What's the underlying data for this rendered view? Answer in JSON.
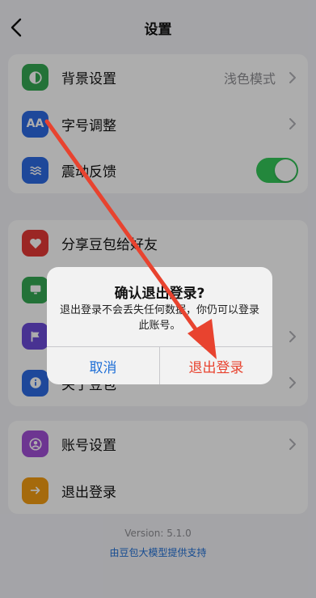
{
  "nav": {
    "title": "设置"
  },
  "groups": {
    "display": [
      {
        "label": "背景设置",
        "value": "浅色模式",
        "icon_text": "",
        "color": "#34a853"
      },
      {
        "label": "字号调整",
        "icon_text": "AA",
        "color": "#2d6be4"
      },
      {
        "label": "震动反馈",
        "toggle_on": true,
        "icon_text": "",
        "color": "#2d6be4"
      }
    ],
    "general": [
      {
        "label": "分享豆包给好友",
        "color": "#e53935"
      },
      {
        "label": "",
        "color": "#34a853"
      },
      {
        "label": "",
        "color": "#6a4bd8"
      },
      {
        "label": "关于豆包",
        "color": "#2d6be4"
      }
    ],
    "account": [
      {
        "label": "账号设置",
        "color": "#a14fd6"
      },
      {
        "label": "退出登录",
        "color": "#f39c12"
      }
    ]
  },
  "footer": {
    "version": "Version: 5.1.0",
    "powered_by": "由豆包大模型提供支持"
  },
  "alert": {
    "title": "确认退出登录?",
    "message": "退出登录不会丢失任何数据，你仍可以登录此账号。",
    "cancel_label": "取消",
    "confirm_label": "退出登录"
  },
  "colors": {
    "accent_blue": "#1f6fd6",
    "destructive": "#e8432f",
    "toggle_on": "#34c759",
    "annotation_arrow": "#e8432f"
  }
}
